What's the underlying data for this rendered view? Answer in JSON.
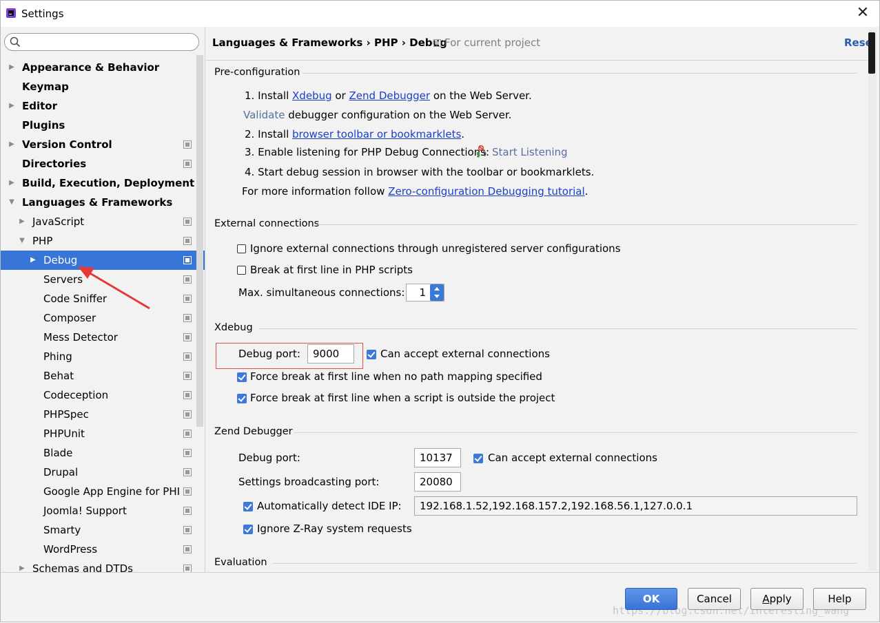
{
  "window": {
    "title": "Settings"
  },
  "sidebar": {
    "search_placeholder": "",
    "items": [
      {
        "label": "Appearance & Behavior",
        "bold": true,
        "arrow": "▶",
        "indent": 0,
        "proj": false
      },
      {
        "label": "Keymap",
        "bold": true,
        "arrow": "",
        "indent": 0,
        "proj": false
      },
      {
        "label": "Editor",
        "bold": true,
        "arrow": "▶",
        "indent": 0,
        "proj": false
      },
      {
        "label": "Plugins",
        "bold": true,
        "arrow": "",
        "indent": 0,
        "proj": false
      },
      {
        "label": "Version Control",
        "bold": true,
        "arrow": "▶",
        "indent": 0,
        "proj": true
      },
      {
        "label": "Directories",
        "bold": true,
        "arrow": "",
        "indent": 0,
        "proj": true
      },
      {
        "label": "Build, Execution, Deployment",
        "bold": true,
        "arrow": "▶",
        "indent": 0,
        "proj": false
      },
      {
        "label": "Languages & Frameworks",
        "bold": true,
        "arrow": "▼",
        "indent": 0,
        "proj": false
      },
      {
        "label": "JavaScript",
        "bold": false,
        "arrow": "▶",
        "indent": 1,
        "proj": true
      },
      {
        "label": "PHP",
        "bold": false,
        "arrow": "▼",
        "indent": 1,
        "proj": true
      },
      {
        "label": "Debug",
        "bold": false,
        "arrow": "▶",
        "indent": 2,
        "proj": true,
        "selected": true
      },
      {
        "label": "Servers",
        "bold": false,
        "arrow": "",
        "indent": 2,
        "proj": true
      },
      {
        "label": "Code Sniffer",
        "bold": false,
        "arrow": "",
        "indent": 2,
        "proj": true
      },
      {
        "label": "Composer",
        "bold": false,
        "arrow": "",
        "indent": 2,
        "proj": true
      },
      {
        "label": "Mess Detector",
        "bold": false,
        "arrow": "",
        "indent": 2,
        "proj": true
      },
      {
        "label": "Phing",
        "bold": false,
        "arrow": "",
        "indent": 2,
        "proj": true
      },
      {
        "label": "Behat",
        "bold": false,
        "arrow": "",
        "indent": 2,
        "proj": true
      },
      {
        "label": "Codeception",
        "bold": false,
        "arrow": "",
        "indent": 2,
        "proj": true
      },
      {
        "label": "PHPSpec",
        "bold": false,
        "arrow": "",
        "indent": 2,
        "proj": true
      },
      {
        "label": "PHPUnit",
        "bold": false,
        "arrow": "",
        "indent": 2,
        "proj": true
      },
      {
        "label": "Blade",
        "bold": false,
        "arrow": "",
        "indent": 2,
        "proj": true
      },
      {
        "label": "Drupal",
        "bold": false,
        "arrow": "",
        "indent": 2,
        "proj": true
      },
      {
        "label": "Google App Engine for PHI",
        "bold": false,
        "arrow": "",
        "indent": 2,
        "proj": true
      },
      {
        "label": "Joomla! Support",
        "bold": false,
        "arrow": "",
        "indent": 2,
        "proj": true
      },
      {
        "label": "Smarty",
        "bold": false,
        "arrow": "",
        "indent": 2,
        "proj": true
      },
      {
        "label": "WordPress",
        "bold": false,
        "arrow": "",
        "indent": 2,
        "proj": true
      },
      {
        "label": "Schemas and DTDs",
        "bold": false,
        "arrow": "▶",
        "indent": 1,
        "proj": true
      }
    ]
  },
  "header": {
    "breadcrumb": "Languages & Frameworks › PHP › Debug",
    "scope_note": "For current project",
    "reset": "Rese"
  },
  "preconfig": {
    "title": "Pre-configuration",
    "step1_prefix": "1. Install",
    "step1_link1": "Xdebug",
    "step1_or": "or",
    "step1_link2": "Zend Debugger",
    "step1_suffix": "on the Web Server.",
    "validate_link": "Validate",
    "validate_text": "debugger configuration on the Web Server.",
    "step2_prefix": "2. Install",
    "step2_link": "browser toolbar or bookmarklets",
    "step2_suffix": ".",
    "step3_text": "3. Enable listening for PHP Debug Connections:",
    "step3_link": "Start Listening",
    "step4_text": "4. Start debug session in browser with the toolbar or bookmarklets.",
    "more_prefix": "For more information follow",
    "more_link": "Zero-configuration Debugging tutorial",
    "more_suffix": "."
  },
  "external": {
    "title": "External connections",
    "ignore_label": "Ignore external connections through unregistered server configurations",
    "break_label": "Break at first line in PHP scripts",
    "max_label": "Max. simultaneous connections:",
    "max_value": "1"
  },
  "xdebug": {
    "title": "Xdebug",
    "port_label": "Debug port:",
    "port_value": "9000",
    "accept_label": "Can accept external connections",
    "force1_label": "Force break at first line when no path mapping specified",
    "force2_label": "Force break at first line when a script is outside the project"
  },
  "zend": {
    "title": "Zend Debugger",
    "port_label": "Debug port:",
    "port_value": "10137",
    "accept_label": "Can accept external connections",
    "broadcast_label": "Settings broadcasting port:",
    "broadcast_value": "20080",
    "detect_label": "Automatically detect IDE IP:",
    "detect_value": "192.168.1.52,192.168.157.2,192.168.56.1,127.0.0.1",
    "ignore_label": "Ignore Z-Ray system requests"
  },
  "evaluation": {
    "title": "Evaluation"
  },
  "buttons": {
    "ok": "OK",
    "cancel": "Cancel",
    "apply_u": "A",
    "apply_rest": "pply",
    "help": "Help"
  },
  "watermark": "https://blog.csdn.net/interesting_wang",
  "colors": {
    "selection": "#3875d7",
    "link": "#1a3ec9",
    "checkbox_on": "#3c78d8",
    "annotation": "#e53935"
  }
}
